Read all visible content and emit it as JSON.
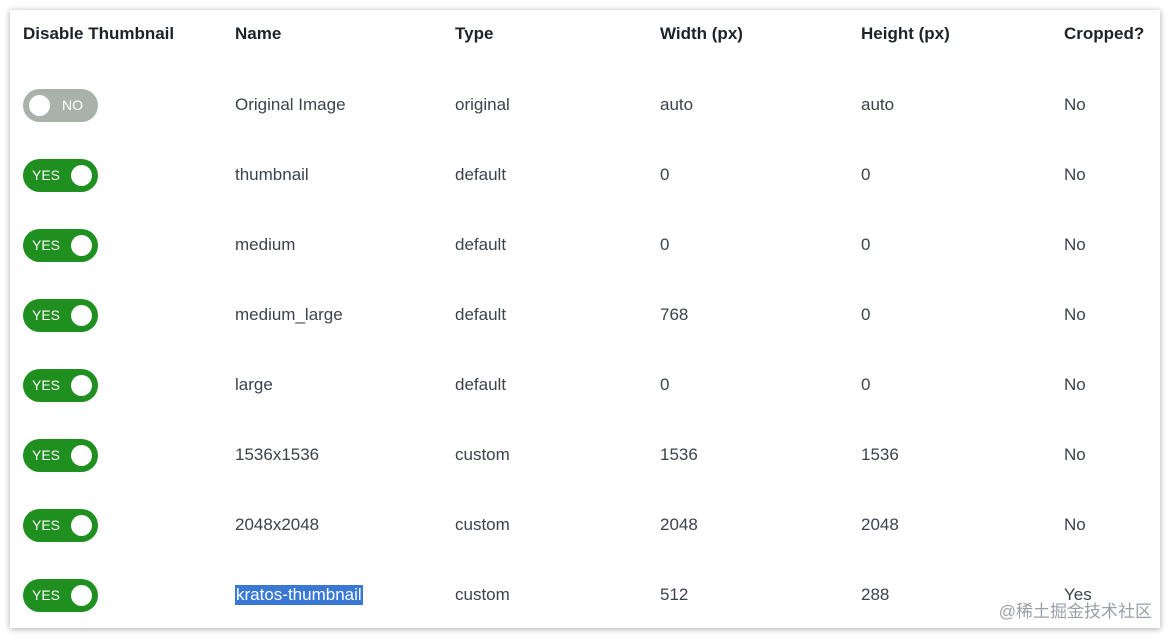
{
  "columns": [
    "Disable Thumbnail",
    "Name",
    "Type",
    "Width (px)",
    "Height (px)",
    "Cropped?"
  ],
  "rows": [
    {
      "toggle": "NO",
      "on": false,
      "name": "Original Image",
      "type": "original",
      "width": "auto",
      "height": "auto",
      "cropped": "No"
    },
    {
      "toggle": "YES",
      "on": true,
      "name": "thumbnail",
      "type": "default",
      "width": "0",
      "height": "0",
      "cropped": "No"
    },
    {
      "toggle": "YES",
      "on": true,
      "name": "medium",
      "type": "default",
      "width": "0",
      "height": "0",
      "cropped": "No"
    },
    {
      "toggle": "YES",
      "on": true,
      "name": "medium_large",
      "type": "default",
      "width": "768",
      "height": "0",
      "cropped": "No"
    },
    {
      "toggle": "YES",
      "on": true,
      "name": "large",
      "type": "default",
      "width": "0",
      "height": "0",
      "cropped": "No"
    },
    {
      "toggle": "YES",
      "on": true,
      "name": "1536x1536",
      "type": "custom",
      "width": "1536",
      "height": "1536",
      "cropped": "No"
    },
    {
      "toggle": "YES",
      "on": true,
      "name": "2048x2048",
      "type": "custom",
      "width": "2048",
      "height": "2048",
      "cropped": "No"
    },
    {
      "toggle": "YES",
      "on": true,
      "name": "kratos-thumbnail",
      "type": "custom",
      "width": "512",
      "height": "288",
      "cropped": "Yes"
    }
  ],
  "colors": {
    "toggle_on": "#1f8f1f",
    "toggle_off": "#a9b1ab",
    "selection": "#3a78d6"
  },
  "watermark": "@稀土掘金技术社区"
}
